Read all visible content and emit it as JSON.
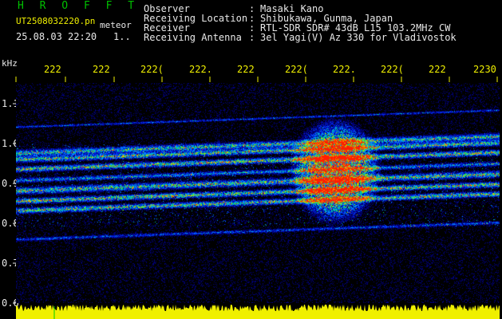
{
  "header": {
    "logo": "H R O F F T",
    "filename": "UT2508032220.pn",
    "meteor_label": "meteor",
    "datetime": "25.08.03 22:20",
    "index": "1..",
    "fields": [
      {
        "label": "Observer",
        "sep": ":",
        "value": "Masaki Kano"
      },
      {
        "label": "Receiving Location",
        "sep": ":",
        "value": "Shibukawa, Gunma, Japan"
      },
      {
        "label": "Receiver",
        "sep": ":",
        "value": "RTL-SDR SDR# 43dB L15 103.2MHz CW"
      },
      {
        "label": "Receiving Antenna",
        "sep": ":",
        "value": "3el Yagi(V) Az 330 for Vladivostok"
      }
    ]
  },
  "plot": {
    "yunit": "kHz",
    "time_ticks": [
      "222",
      "222",
      "222(",
      "222.",
      "222 ",
      "222(",
      "222.",
      "222(",
      "222 ",
      "2230"
    ],
    "freq_ticks": [
      "1.1",
      "1.0",
      "0.9",
      "0.8",
      "0.7",
      "0.6"
    ]
  },
  "colors": {
    "logo": "#00c000",
    "text": "#e8e8e8",
    "ticks": "#f0f000",
    "baseline": "#f0f000",
    "background": "#000000"
  }
}
